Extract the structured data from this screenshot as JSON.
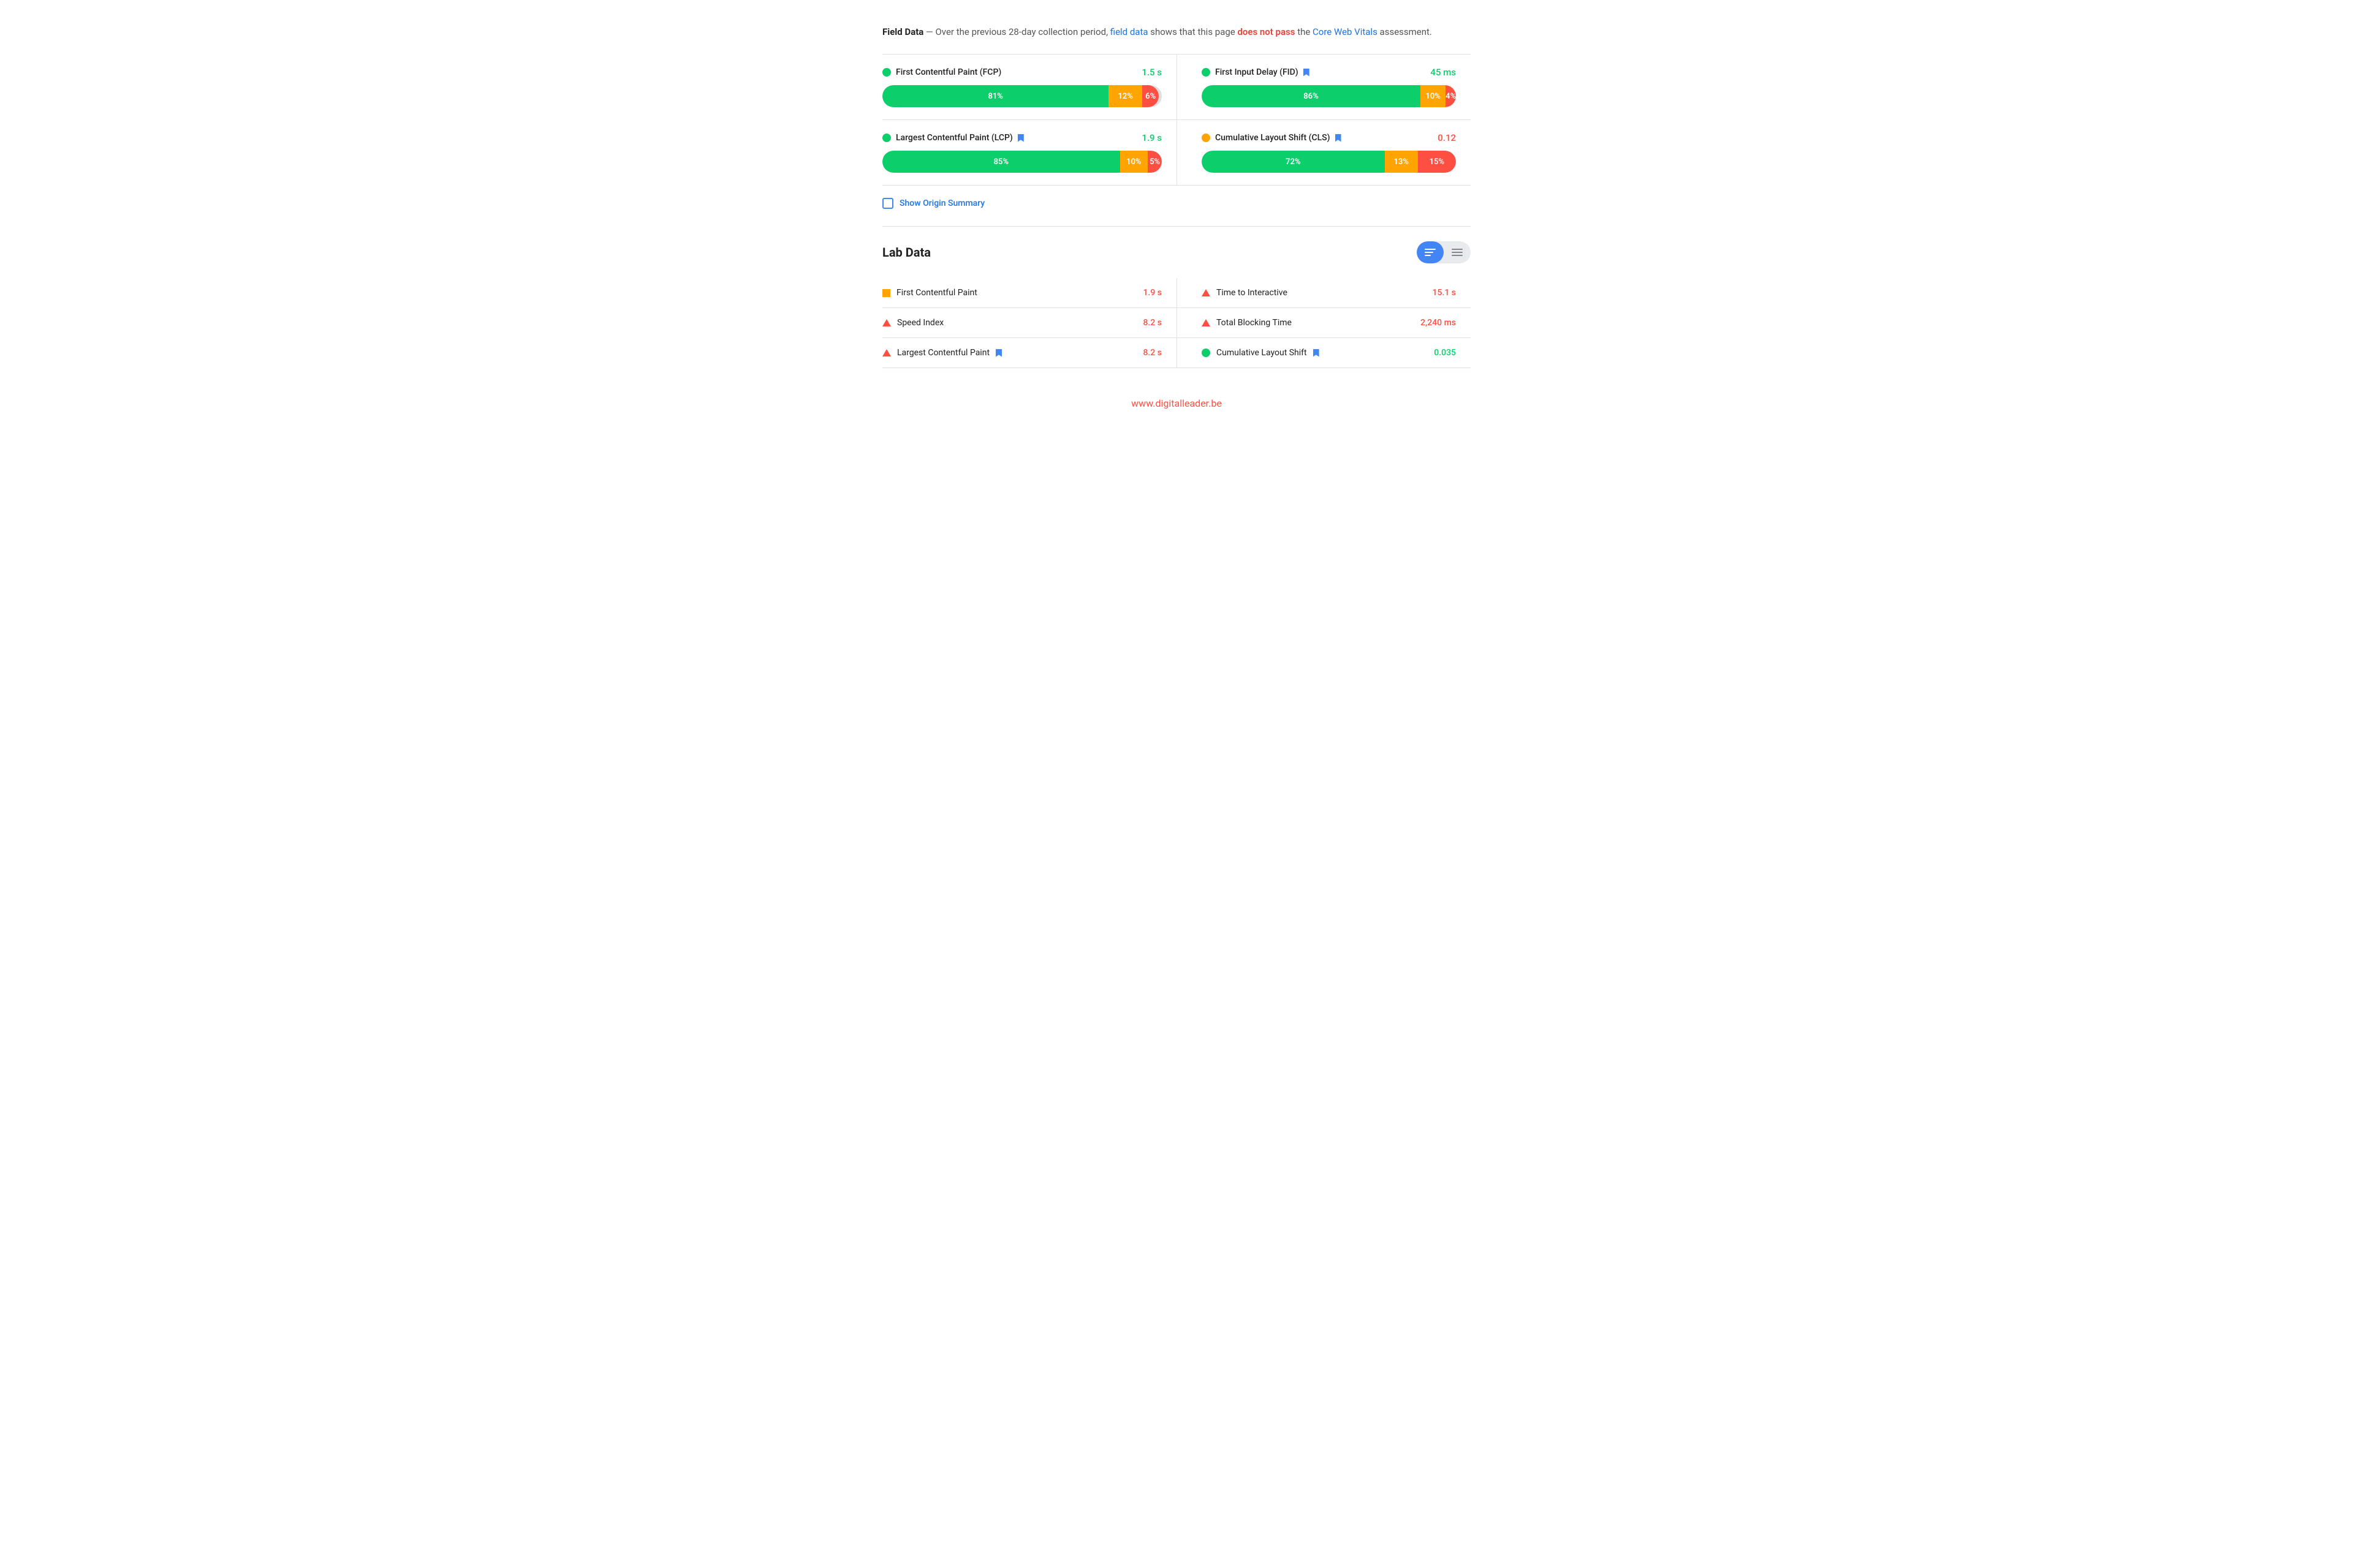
{
  "field_data": {
    "intro": {
      "prefix": "Field Data",
      "dash": " — Over the previous 28-day collection period, ",
      "link_field": "field data",
      "middle": " shows that this page ",
      "does_not_pass": "does not pass",
      "suffix": " the ",
      "core_web_vitals": "Core Web Vitals",
      "assessment": " assessment."
    },
    "metrics": [
      {
        "id": "fcp",
        "name": "First Contentful Paint (FCP)",
        "dot_color": "green",
        "value": "1.5 s",
        "value_color": "green",
        "has_bookmark": false,
        "bar": {
          "green": 81,
          "orange": 12,
          "red": 6
        }
      },
      {
        "id": "fid",
        "name": "First Input Delay (FID)",
        "dot_color": "green",
        "value": "45 ms",
        "value_color": "green",
        "has_bookmark": true,
        "bar": {
          "green": 86,
          "orange": 10,
          "red": 4
        }
      },
      {
        "id": "lcp",
        "name": "Largest Contentful Paint (LCP)",
        "dot_color": "green",
        "value": "1.9 s",
        "value_color": "green",
        "has_bookmark": true,
        "bar": {
          "green": 85,
          "orange": 10,
          "red": 5
        }
      },
      {
        "id": "cls",
        "name": "Cumulative Layout Shift (CLS)",
        "dot_color": "orange",
        "value": "0.12",
        "value_color": "red",
        "has_bookmark": true,
        "bar": {
          "green": 72,
          "orange": 13,
          "red": 15
        }
      }
    ],
    "show_origin_summary": "Show Origin Summary"
  },
  "lab_data": {
    "title": "Lab Data",
    "toggle": {
      "bar_view": "bar-view",
      "list_view": "list-view"
    },
    "metrics": [
      {
        "id": "fcp-lab",
        "name": "First Contentful Paint",
        "icon": "square",
        "value": "1.9 s",
        "value_color": "red",
        "has_bookmark": false
      },
      {
        "id": "tti",
        "name": "Time to Interactive",
        "icon": "triangle",
        "value": "15.1 s",
        "value_color": "red",
        "has_bookmark": false
      },
      {
        "id": "si",
        "name": "Speed Index",
        "icon": "triangle",
        "value": "8.2 s",
        "value_color": "red",
        "has_bookmark": false
      },
      {
        "id": "tbt",
        "name": "Total Blocking Time",
        "icon": "triangle",
        "value": "2,240 ms",
        "value_color": "red",
        "has_bookmark": false
      },
      {
        "id": "lcp-lab",
        "name": "Largest Contentful Paint",
        "icon": "triangle",
        "value": "8.2 s",
        "value_color": "red",
        "has_bookmark": true
      },
      {
        "id": "cls-lab",
        "name": "Cumulative Layout Shift",
        "icon": "dot-green",
        "value": "0.035",
        "value_color": "green",
        "has_bookmark": true
      }
    ]
  },
  "footer": {
    "url": "www.digitalleader.be"
  }
}
